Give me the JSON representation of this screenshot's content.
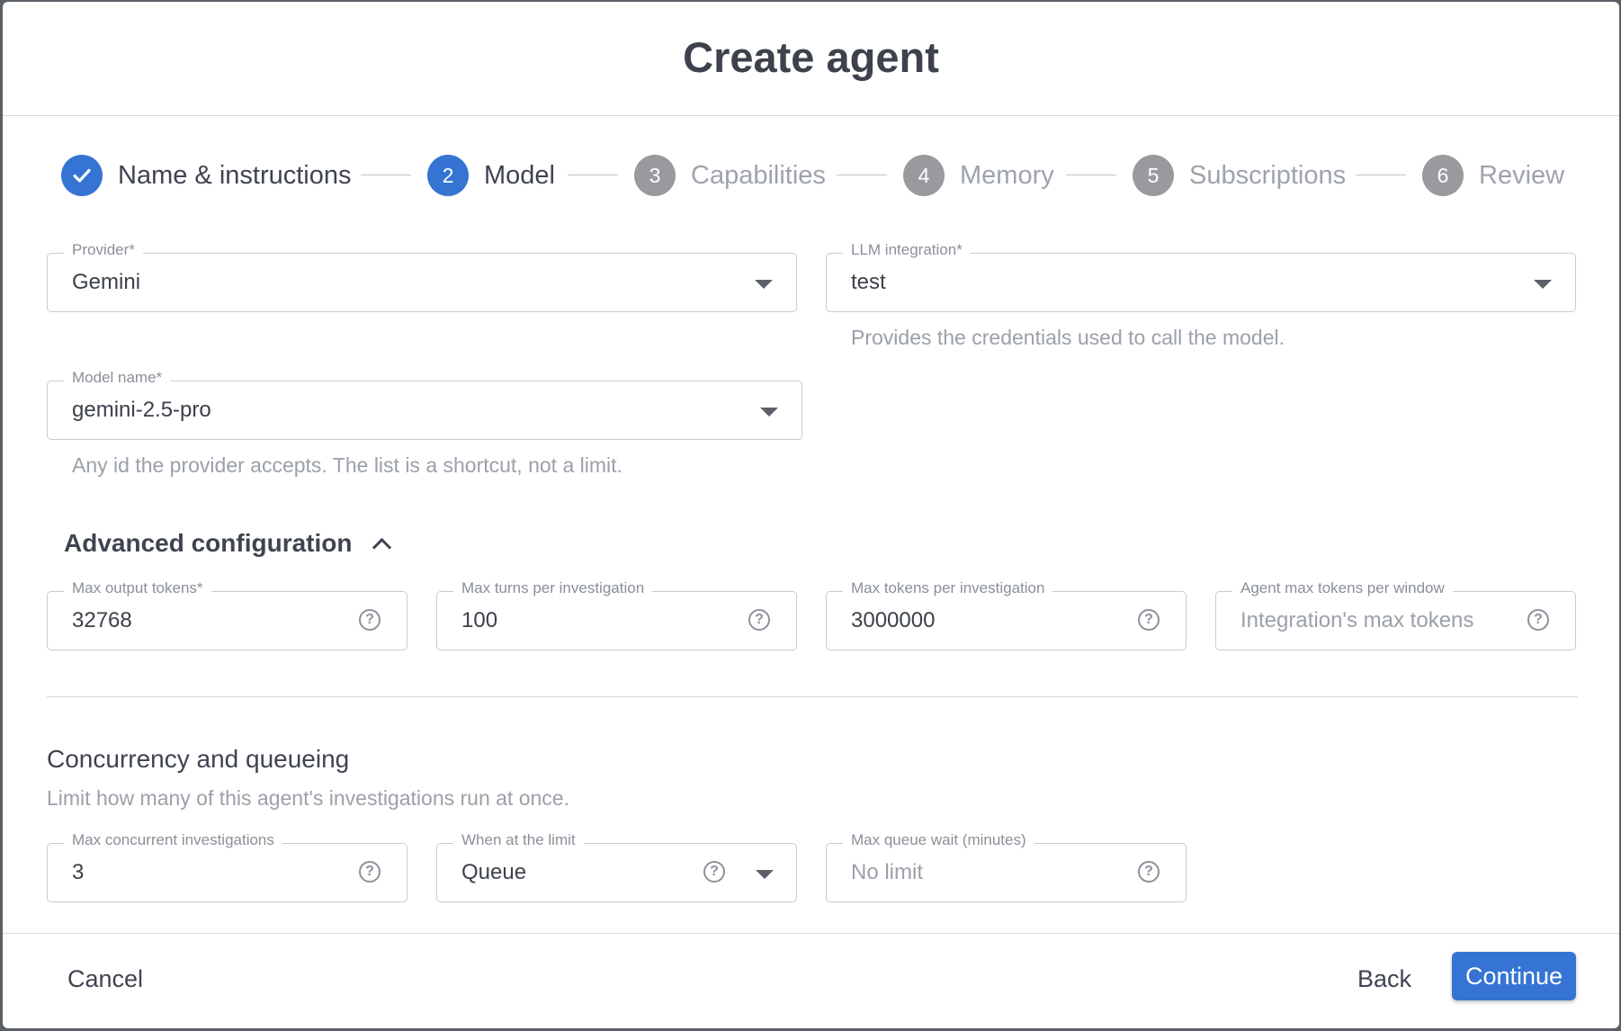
{
  "dialog": {
    "title": "Create agent"
  },
  "stepper": {
    "steps": [
      {
        "number": "1",
        "label": "Name & instructions",
        "state": "done"
      },
      {
        "number": "2",
        "label": "Model",
        "state": "active"
      },
      {
        "number": "3",
        "label": "Capabilities",
        "state": "todo"
      },
      {
        "number": "4",
        "label": "Memory",
        "state": "todo"
      },
      {
        "number": "5",
        "label": "Subscriptions",
        "state": "todo"
      },
      {
        "number": "6",
        "label": "Review",
        "state": "todo"
      }
    ]
  },
  "model": {
    "provider": {
      "label": "Provider",
      "required_mark": "*",
      "value": "Gemini"
    },
    "llm_integration": {
      "label": "LLM integration",
      "required_mark": "*",
      "value": "test",
      "helper": "Provides the credentials used to call the model."
    },
    "model_name": {
      "label": "Model name",
      "required_mark": "*",
      "value": "gemini-2.5-pro",
      "helper": "Any id the provider accepts. The list is a shortcut, not a limit."
    }
  },
  "advanced": {
    "title": "Advanced configuration",
    "expanded": true,
    "max_output_tokens": {
      "label": "Max output tokens",
      "required_mark": "*",
      "value": "32768"
    },
    "max_turns": {
      "label": "Max turns per investigation",
      "value": "100"
    },
    "max_tokens_investigation": {
      "label": "Max tokens per investigation",
      "value": "3000000"
    },
    "agent_max_tokens_window": {
      "label": "Agent max tokens per window",
      "placeholder": "Integration's max tokens"
    }
  },
  "concurrency": {
    "title": "Concurrency and queueing",
    "subtitle": "Limit how many of this agent's investigations run at once.",
    "max_concurrent": {
      "label": "Max concurrent investigations",
      "value": "3"
    },
    "when_at_limit": {
      "label": "When at the limit",
      "value": "Queue"
    },
    "max_queue_wait": {
      "label": "Max queue wait (minutes)",
      "placeholder": "No limit"
    }
  },
  "footer": {
    "cancel": "Cancel",
    "back": "Back",
    "continue": "Continue"
  },
  "colors": {
    "accent": "#3574d3",
    "inactive_step": "#999a9e",
    "text": "#3f4450",
    "muted": "#9ba0a9"
  }
}
